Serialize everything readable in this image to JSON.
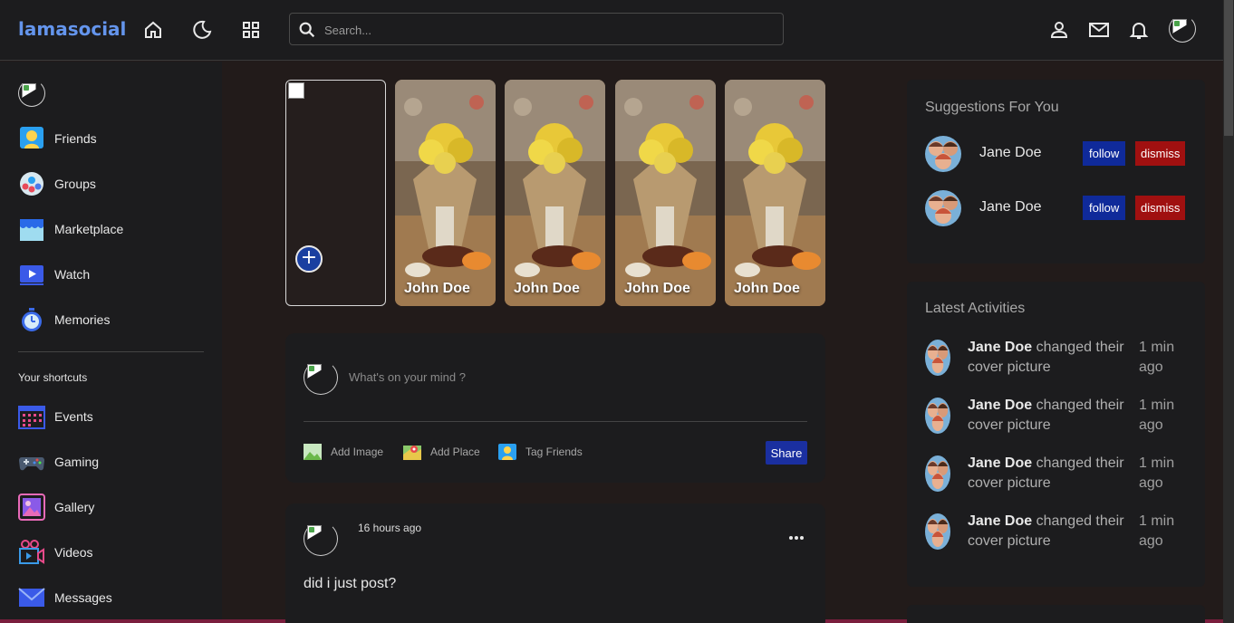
{
  "app": {
    "logo": "lamasocial",
    "accent": "#6495ed"
  },
  "nav": {
    "icons": [
      "home-icon",
      "dark-mode-icon",
      "grid-icon"
    ],
    "search_placeholder": "Search...",
    "right_icons": [
      "person-icon",
      "mail-icon",
      "bell-icon",
      "avatar"
    ]
  },
  "sidebar": {
    "items": [
      {
        "label": "Friends",
        "icon": "friends-icon"
      },
      {
        "label": "Groups",
        "icon": "groups-icon"
      },
      {
        "label": "Marketplace",
        "icon": "marketplace-icon"
      },
      {
        "label": "Watch",
        "icon": "watch-icon"
      },
      {
        "label": "Memories",
        "icon": "memories-icon"
      }
    ],
    "shortcuts_heading": "Your shortcuts",
    "shortcuts": [
      {
        "label": "Events",
        "icon": "events-icon"
      },
      {
        "label": "Gaming",
        "icon": "gaming-icon"
      },
      {
        "label": "Gallery",
        "icon": "gallery-icon"
      },
      {
        "label": "Videos",
        "icon": "videos-icon"
      },
      {
        "label": "Messages",
        "icon": "messages-icon"
      }
    ]
  },
  "stories": {
    "add_label": "+",
    "items": [
      {
        "name": "John Doe"
      },
      {
        "name": "John Doe"
      },
      {
        "name": "John Doe"
      },
      {
        "name": "John Doe"
      }
    ]
  },
  "share": {
    "placeholder": "What's on your mind ?",
    "options": [
      {
        "label": "Add Image",
        "icon": "image-icon"
      },
      {
        "label": "Add Place",
        "icon": "map-icon"
      },
      {
        "label": "Tag Friends",
        "icon": "tag-friends-icon"
      }
    ],
    "button": "Share"
  },
  "post": {
    "time": "16 hours ago",
    "text": "did i just post?"
  },
  "suggestions": {
    "title": "Suggestions For You",
    "items": [
      {
        "name": "Jane Doe",
        "follow": "follow",
        "dismiss": "dismiss"
      },
      {
        "name": "Jane Doe",
        "follow": "follow",
        "dismiss": "dismiss"
      }
    ]
  },
  "activities": {
    "title": "Latest Activities",
    "items": [
      {
        "name": "Jane Doe",
        "action": "changed their cover picture",
        "time": "1 min ago"
      },
      {
        "name": "Jane Doe",
        "action": "changed their cover picture",
        "time": "1 min ago"
      },
      {
        "name": "Jane Doe",
        "action": "changed their cover picture",
        "time": "1 min ago"
      },
      {
        "name": "Jane Doe",
        "action": "changed their cover picture",
        "time": "1 min ago"
      }
    ]
  }
}
